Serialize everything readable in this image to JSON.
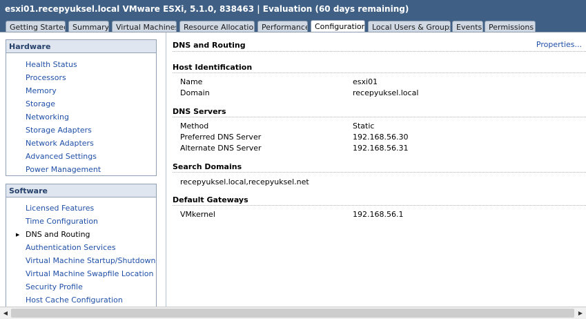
{
  "window": {
    "title": "esxi01.recepyuksel.local VMware ESXi, 5.1.0, 838463 | Evaluation (60 days remaining)"
  },
  "tabs": [
    {
      "label": "Getting Started"
    },
    {
      "label": "Summary"
    },
    {
      "label": "Virtual Machines"
    },
    {
      "label": "Resource Allocation"
    },
    {
      "label": "Performance"
    },
    {
      "label": "Configuration",
      "active": true
    },
    {
      "label": "Local Users & Groups"
    },
    {
      "label": "Events"
    },
    {
      "label": "Permissions"
    }
  ],
  "hardware": {
    "header": "Hardware",
    "items": [
      "Health Status",
      "Processors",
      "Memory",
      "Storage",
      "Networking",
      "Storage Adapters",
      "Network Adapters",
      "Advanced Settings",
      "Power Management"
    ]
  },
  "software": {
    "header": "Software",
    "items": [
      "Licensed Features",
      "Time Configuration",
      "DNS and Routing",
      "Authentication Services",
      "Virtual Machine Startup/Shutdown",
      "Virtual Machine Swapfile Location",
      "Security Profile",
      "Host Cache Configuration"
    ],
    "selected": "DNS and Routing"
  },
  "main": {
    "title": "DNS and Routing",
    "properties_link": "Properties...",
    "host_identification": {
      "heading": "Host Identification",
      "name_label": "Name",
      "name_value": "esxi01",
      "domain_label": "Domain",
      "domain_value": "recepyuksel.local"
    },
    "dns_servers": {
      "heading": "DNS Servers",
      "method_label": "Method",
      "method_value": "Static",
      "preferred_label": "Preferred DNS Server",
      "preferred_value": "192.168.56.30",
      "alternate_label": "Alternate DNS Server",
      "alternate_value": "192.168.56.31"
    },
    "search_domains": {
      "heading": "Search Domains",
      "value": "recepyuksel.local,recepyuksel.net"
    },
    "default_gateways": {
      "heading": "Default Gateways",
      "vmkernel_label": "VMkernel",
      "vmkernel_value": "192.168.56.1"
    }
  }
}
